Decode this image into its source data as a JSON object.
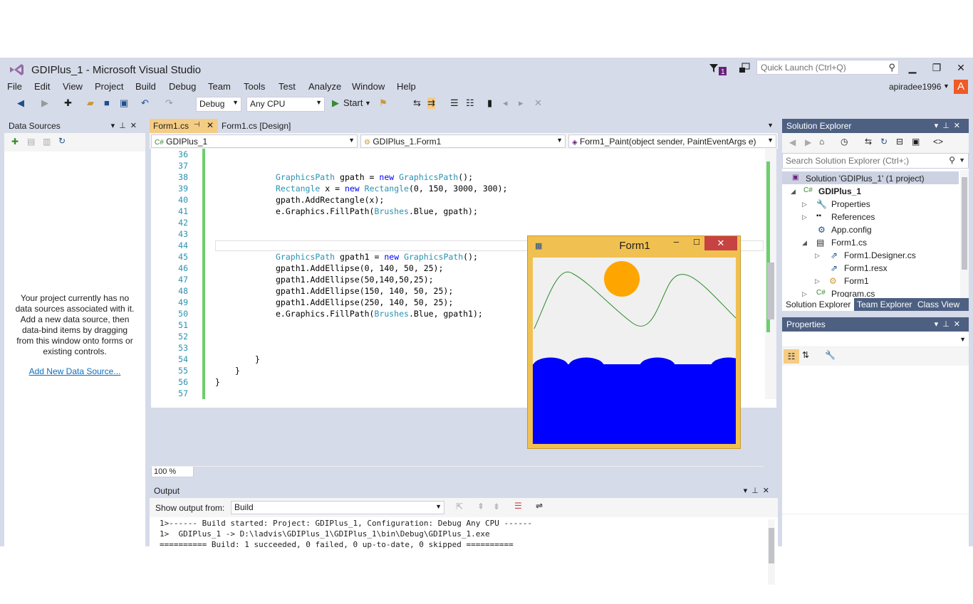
{
  "window": {
    "title": "GDIPlus_1 - Microsoft Visual Studio",
    "quick_launch_placeholder": "Quick Launch (Ctrl+Q)",
    "notification_count": "1",
    "user": "apiradee1996",
    "avatar_letter": "A"
  },
  "menu": [
    "File",
    "Edit",
    "View",
    "Project",
    "Build",
    "Debug",
    "Team",
    "Tools",
    "Test",
    "Analyze",
    "Window",
    "Help"
  ],
  "toolbar": {
    "config": "Debug",
    "platform": "Any CPU",
    "start_label": "Start"
  },
  "data_sources": {
    "title": "Data Sources",
    "message": "Your project currently has no data sources associated with it. Add a new data source, then data-bind items by dragging from this window onto forms or existing controls.",
    "link": "Add New Data Source..."
  },
  "editor": {
    "tabs": [
      "Form1.cs",
      "Form1.cs [Design]"
    ],
    "nav_project": "GDIPlus_1",
    "nav_class": "GDIPlus_1.Form1",
    "nav_member": "Form1_Paint(object sender, PaintEventArgs e)",
    "zoom": "100 %",
    "line_numbers": [
      "36",
      "37",
      "38",
      "39",
      "40",
      "41",
      "42",
      "43",
      "44",
      "45",
      "46",
      "47",
      "48",
      "49",
      "50",
      "51",
      "52",
      "53",
      "54",
      "55",
      "56",
      "57"
    ],
    "code": {
      "l38": "GraphicsPath gpath = new GraphicsPath();",
      "l39": "Rectangle x = new Rectangle(0, 150, 3000, 300);",
      "l40": "gpath.AddRectangle(x);",
      "l41": "e.Graphics.FillPath(Brushes.Blue, gpath);",
      "l45": "GraphicsPath gpath1 = new GraphicsPath();",
      "l46": "gpath1.AddEllipse(0, 140, 50, 25);",
      "l47": "gpath1.AddEllipse(50,140,50,25);",
      "l48": "gpath1.AddEllipse(150, 140, 50, 25);",
      "l49": "gpath1.AddEllipse(250, 140, 50, 25);",
      "l50": "e.Graphics.FillPath(Brushes.Blue, gpath1);",
      "l54": "}",
      "l55": "}",
      "l56": "}"
    }
  },
  "form_window": {
    "title": "Form1",
    "colors": {
      "sun": "#ffa500",
      "water": "#0000ff",
      "mountain": "#2e8b2e"
    }
  },
  "output": {
    "title": "Output",
    "show_from_label": "Show output from:",
    "source": "Build",
    "lines": [
      "1>------ Build started: Project: GDIPlus_1, Configuration: Debug Any CPU ------",
      "1>  GDIPlus_1 -> D:\\ladvis\\GDIPlus_1\\GDIPlus_1\\bin\\Debug\\GDIPlus_1.exe",
      "========== Build: 1 succeeded, 0 failed, 0 up-to-date, 0 skipped =========="
    ]
  },
  "solution_explorer": {
    "title": "Solution Explorer",
    "search_placeholder": "Search Solution Explorer (Ctrl+;)",
    "items": {
      "solution": "Solution 'GDIPlus_1' (1 project)",
      "project": "GDIPlus_1",
      "properties": "Properties",
      "references": "References",
      "appconfig": "App.config",
      "form1cs": "Form1.cs",
      "designer": "Form1.Designer.cs",
      "resx": "Form1.resx",
      "form1": "Form1",
      "program": "Program.cs"
    },
    "bottom_tabs": [
      "Solution Explorer",
      "Team Explorer",
      "Class View"
    ]
  },
  "properties": {
    "title": "Properties"
  }
}
